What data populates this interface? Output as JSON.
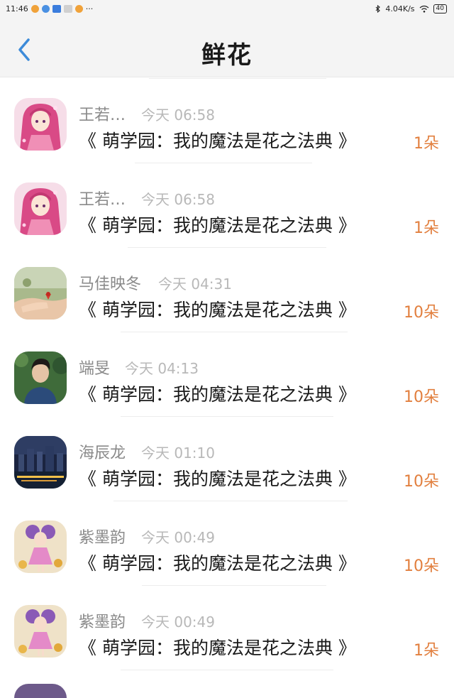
{
  "status_bar": {
    "time": "11:46",
    "more": "···",
    "network_speed": "4.04K/s",
    "battery": "40"
  },
  "header": {
    "title": "鲜花"
  },
  "items": [
    {
      "name": "王若…",
      "time": "今天 06:58",
      "book": "《 萌学园：我的魔法是花之法典 》",
      "count": "1朵",
      "avatar": "pink-anime-girl"
    },
    {
      "name": "王若…",
      "time": "今天 06:58",
      "book": "《 萌学园：我的魔法是花之法典 》",
      "count": "1朵",
      "avatar": "pink-anime-girl"
    },
    {
      "name": "马佳映冬",
      "time": "今天 04:31",
      "book": "《 萌学园：我的魔法是花之法典 》",
      "count": "10朵",
      "avatar": "hand-flower"
    },
    {
      "name": "端旻",
      "time": "今天 04:13",
      "book": "《 萌学园：我的魔法是花之法典 》",
      "count": "10朵",
      "avatar": "young-man"
    },
    {
      "name": "海辰龙",
      "time": "今天 01:10",
      "book": "《 萌学园：我的魔法是花之法典 》",
      "count": "10朵",
      "avatar": "night-city"
    },
    {
      "name": "紫墨韵",
      "time": "今天 00:49",
      "book": "《 萌学园：我的魔法是花之法典 》",
      "count": "10朵",
      "avatar": "purple-fairy"
    },
    {
      "name": "紫墨韵",
      "time": "今天 00:49",
      "book": "《 萌学园：我的魔法是花之法典 》",
      "count": "1朵",
      "avatar": "purple-fairy"
    }
  ]
}
